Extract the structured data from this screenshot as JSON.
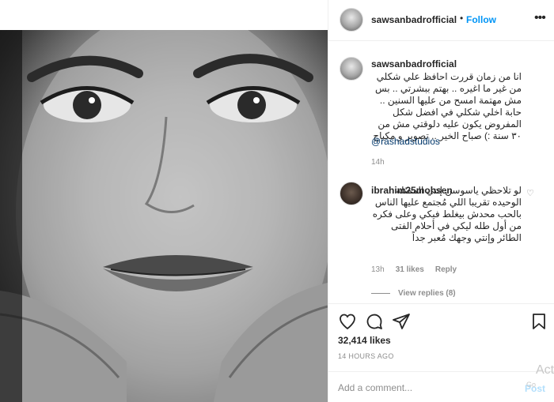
{
  "post": {
    "username": "sawsanbadrofficial",
    "dot": "•",
    "follow_label": "Follow",
    "more_icon": "more-options-icon"
  },
  "caption": {
    "username": "sawsanbadrofficial",
    "text": "انا من زمان قررت احافظ علي شكلي من غير ما اغيره .. بهتم ببشرتي .. بس مش مهتمة امسح من عليها السنين .. حابة اخلي شكلي في افضل شكل المفروض يكون عليه دلوقتي مش من ٣٠ سنة :) صباح الخير .. تصوير و مكياج",
    "mention": "@rashadstudios",
    "time": "14h"
  },
  "comment": {
    "username": "ibrahim25mohsen",
    "text": "لو تلاحظي ياسوسن إنتي الممثله الوحيده تقريبا اللي مُجتمع عليها الناس بالحب محدش بيغلط فيكي وعلى فكره من أول طله ليكي في أحلام الفتى الطائر وإنتي وجهك مُعبر جداً",
    "time": "13h",
    "likes": "31 likes",
    "reply_label": "Reply",
    "view_replies": "View replies (8)"
  },
  "actions": {
    "icons": [
      "heart-icon",
      "comment-icon",
      "share-icon",
      "save-icon"
    ]
  },
  "likes_count": "32,414 likes",
  "post_time": "14 HOURS AGO",
  "add_comment": {
    "placeholder": "Add a comment...",
    "post_label": "Post"
  },
  "overlay": {
    "act": "Act",
    "go": "Go"
  },
  "colors": {
    "accent": "#0095f6",
    "muted": "#8e8e8e",
    "mention": "#00376b"
  }
}
